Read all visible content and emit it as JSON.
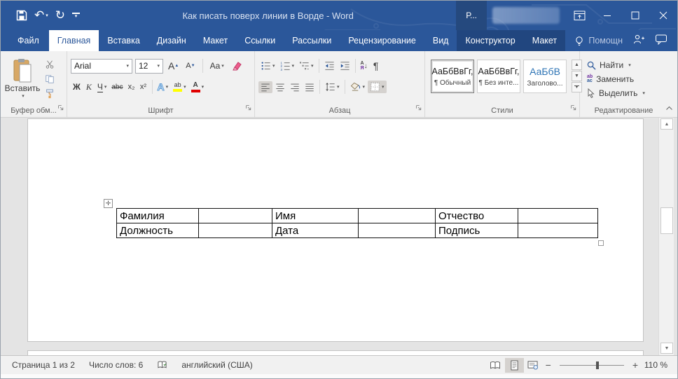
{
  "window": {
    "title": "Как писать поверх линии в Ворде - Word",
    "user_badge": "Р..."
  },
  "tabs": {
    "items": [
      {
        "label": "Файл"
      },
      {
        "label": "Главная"
      },
      {
        "label": "Вставка"
      },
      {
        "label": "Дизайн"
      },
      {
        "label": "Макет"
      },
      {
        "label": "Ссылки"
      },
      {
        "label": "Рассылки"
      },
      {
        "label": "Рецензирование"
      },
      {
        "label": "Вид"
      },
      {
        "label": "Конструктор"
      },
      {
        "label": "Макет"
      }
    ],
    "tell_me": "Помощн"
  },
  "ribbon": {
    "clipboard": {
      "paste": "Вставить",
      "label": "Буфер обм..."
    },
    "font": {
      "label": "Шрифт",
      "name": "Arial",
      "size": "12",
      "grow": "A",
      "shrink": "A",
      "case": "Aa",
      "bold": "Ж",
      "italic": "К",
      "underline": "Ч",
      "strike": "abc",
      "subscript": "x₂",
      "superscript": "x²",
      "effects": "А",
      "highlight": "ab",
      "color": "А"
    },
    "paragraph": {
      "label": "Абзац",
      "sort_top": "А",
      "sort_bottom": "Я",
      "sort_arrow": "↓",
      "marks": "¶"
    },
    "styles": {
      "label": "Стили",
      "items": [
        {
          "preview": "АаБбВвГг,",
          "name": "¶ Обычный"
        },
        {
          "preview": "АаБбВвГг,",
          "name": "¶ Без инте..."
        },
        {
          "preview": "АаБбВ",
          "name": "Заголово..."
        }
      ]
    },
    "editing": {
      "label": "Редактирование",
      "find": "Найти",
      "replace": "Заменить",
      "select": "Выделить"
    }
  },
  "document": {
    "table": {
      "rows": [
        [
          "Фамилия",
          "",
          "Имя",
          "",
          "Отчество",
          ""
        ],
        [
          "Должность",
          "",
          "Дата",
          "",
          "Подпись",
          ""
        ]
      ]
    }
  },
  "status_bar": {
    "page": "Страница 1 из 2",
    "words": "Число слов: 6",
    "language": "английский (США)",
    "zoom_minus": "−",
    "zoom_plus": "+",
    "zoom": "110 %"
  }
}
